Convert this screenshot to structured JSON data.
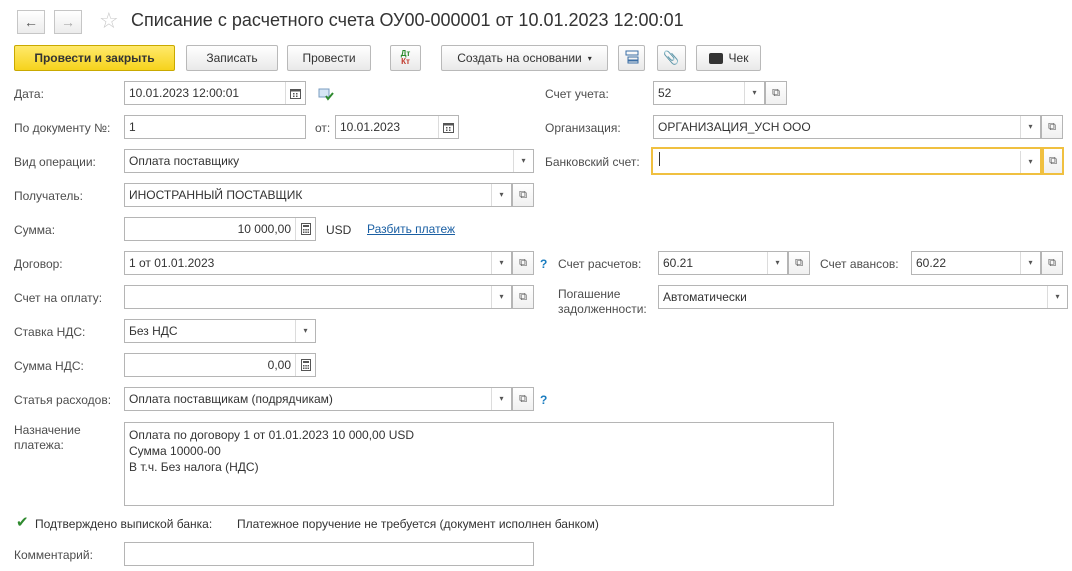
{
  "window": {
    "title": "Списание с расчетного счета ОУ00-000001 от 10.01.2023 12:00:01"
  },
  "toolbar": {
    "post_close": "Провести и закрыть",
    "save": "Записать",
    "post": "Провести",
    "dtkt_top": "Дт",
    "dtkt_bottom": "Кт",
    "create_based": "Создать на основании",
    "check": "Чек"
  },
  "form": {
    "date_label": "Дата:",
    "date_value": "10.01.2023 12:00:01",
    "doc_no_label": "По документу №:",
    "doc_no_value": "1",
    "from_label": "от:",
    "from_value": "10.01.2023",
    "op_type_label": "Вид операции:",
    "op_type_value": "Оплата поставщику",
    "recipient_label": "Получатель:",
    "recipient_value": "ИНОСТРАННЫЙ ПОСТАВЩИК",
    "amount_label": "Сумма:",
    "amount_value": "10 000,00",
    "currency": "USD",
    "split_link": "Разбить платеж",
    "contract_label": "Договор:",
    "contract_value": "1 от 01.01.2023",
    "invoice_label": "Счет на оплату:",
    "invoice_value": "",
    "vat_rate_label": "Ставка НДС:",
    "vat_rate_value": "Без НДС",
    "vat_amount_label": "Сумма НДС:",
    "vat_amount_value": "0,00",
    "expense_label": "Статья расходов:",
    "expense_value": "Оплата поставщикам (подрядчикам)",
    "purpose_label_1": "Назначение",
    "purpose_label_2": "платежа:",
    "purpose_value": "Оплата по договору 1 от 01.01.2023 10 000,00 USD\nСумма 10000-00\nВ т.ч. Без налога (НДС)",
    "bank_confirmed_label": "Подтверждено выпиской банка:",
    "bank_confirmed_checked": true,
    "bank_note": "Платежное поручение не требуется (документ исполнен банком)",
    "comment_label": "Комментарий:",
    "comment_value": "",
    "account_label": "Счет учета:",
    "account_value": "52",
    "org_label": "Организация:",
    "org_value": "ОРГАНИЗАЦИЯ_УСН ООО",
    "bank_account_label": "Банковский счет:",
    "bank_account_value": "",
    "settle_label": "Счет расчетов:",
    "settle_value": "60.21",
    "advance_label": "Счет авансов:",
    "advance_value": "60.22",
    "debt_label_1": "Погашение",
    "debt_label_2": "задолженности:",
    "debt_value": "Автоматически",
    "help": "?"
  },
  "colors": {
    "primary_button": "#f6d31c",
    "focus_border": "#f0c040",
    "link": "#1a5fa3",
    "help": "#1a7cbf",
    "check": "#2f8a2f"
  }
}
